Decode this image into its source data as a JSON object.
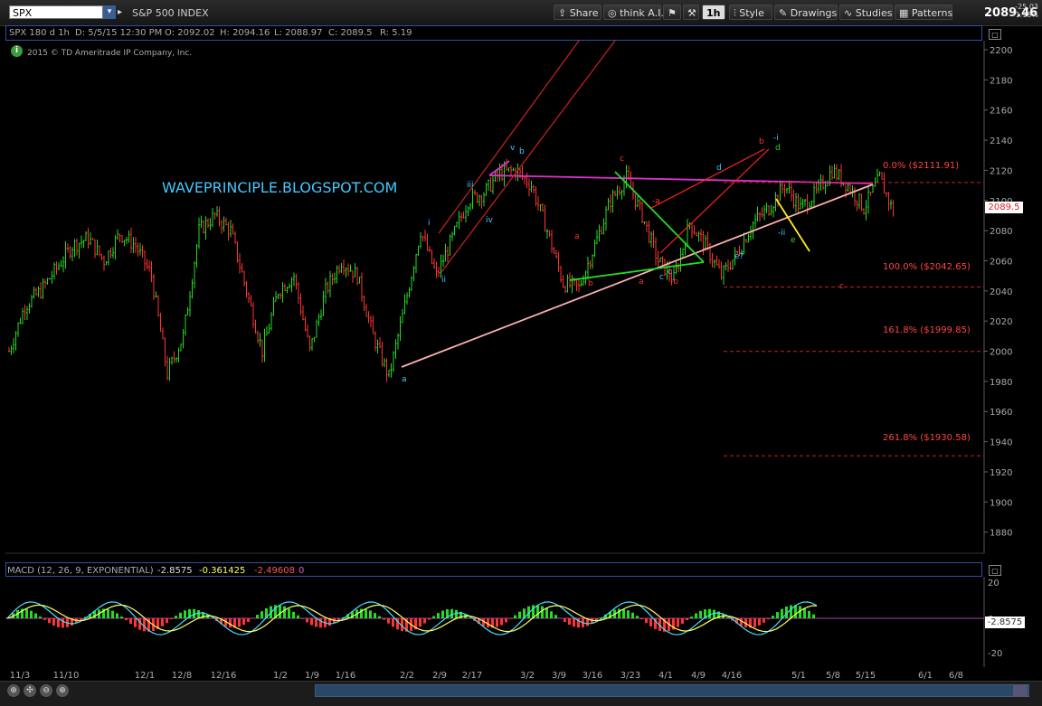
{
  "toolbar": {
    "symbol": "SPX",
    "description": "S&P 500 INDEX",
    "buttons": [
      {
        "name": "share-button",
        "label": "Share"
      },
      {
        "name": "think-ai-button",
        "label": "think A.I."
      },
      {
        "name": "timeframe-button",
        "label": "1h"
      },
      {
        "name": "style-button",
        "label": "Style"
      },
      {
        "name": "drawings-button",
        "label": "Drawings"
      },
      {
        "name": "studies-button",
        "label": "Studies"
      },
      {
        "name": "patterns-button",
        "label": "Patterns"
      }
    ],
    "last_price": "2089.46",
    "change": "-25.03",
    "change_pct": "-1.18%"
  },
  "infobar": {
    "chart_id": "SPX 180 d 1h",
    "date": "D: 5/5/15 12:30 PM",
    "open": "O: 2092.02",
    "high": "H: 2094.16",
    "low": "L: 2088.97",
    "close": "C: 2089.5",
    "range": "R: 5.19"
  },
  "copyright": "2015 © TD Ameritrade IP Company, Inc.",
  "watermark": "WAVEPRINCIPLE.BLOGSPOT.COM",
  "price_tag": "2089.5",
  "fib_levels": [
    {
      "label": "0.0%  ($2111.91)",
      "value": 2111.91
    },
    {
      "label": "100.0%  ($2042.65)",
      "value": 2042.65
    },
    {
      "label": "161.8%  ($1999.85)",
      "value": 1999.85
    },
    {
      "label": "261.8%  ($1930.58)",
      "value": 1930.58
    }
  ],
  "wave_labels": [
    {
      "t": "a",
      "color": "#44c8ff"
    },
    {
      "t": "i",
      "color": "#44c8ff"
    },
    {
      "t": "ii",
      "color": "#44c8ff"
    },
    {
      "t": "iii",
      "color": "#44c8ff"
    },
    {
      "t": "iv",
      "color": "#44c8ff"
    },
    {
      "t": "v",
      "color": "#44c8ff"
    },
    {
      "t": "b",
      "color": "#44c8ff"
    },
    {
      "t": "c",
      "color": "#ff3333"
    },
    {
      "t": "a",
      "color": "#ff3333"
    },
    {
      "t": "b",
      "color": "#ff3333"
    },
    {
      "t": "-a",
      "color": "#ff3333"
    },
    {
      "t": "a",
      "color": "#ff3333"
    },
    {
      "t": "c",
      "color": "#44c8ff"
    },
    {
      "t": "c",
      "color": "#44c8ff"
    },
    {
      "t": "-b",
      "color": "#ff3333"
    },
    {
      "t": "d",
      "color": "#44c8ff"
    },
    {
      "t": "e?",
      "color": "#44c8ff"
    },
    {
      "t": "b",
      "color": "#ff3333"
    },
    {
      "t": "-i",
      "color": "#44c8ff"
    },
    {
      "t": "d",
      "color": "#22dd22"
    },
    {
      "t": "-ii",
      "color": "#44c8ff"
    },
    {
      "t": "e",
      "color": "#22dd22"
    },
    {
      "t": "c",
      "color": "#ff3333"
    }
  ],
  "macd": {
    "title": "MACD (12, 26, 9, EXPONENTIAL)",
    "value": "-2.8575",
    "avg": "-0.361425",
    "diff": "-2.49608",
    "zero": "0",
    "tag": "-2.8575",
    "axis": [
      "20",
      "0",
      "-20"
    ]
  },
  "chart_data": {
    "type": "candlestick",
    "title": "SPX 180 d 1h",
    "y_ticks": [
      2200,
      2180,
      2160,
      2140,
      2120,
      2100,
      2080,
      2060,
      2040,
      2020,
      2000,
      1980,
      1960,
      1940,
      1920,
      1900,
      1880
    ],
    "ylim": [
      1866,
      2206
    ],
    "x_ticks": [
      "11/3",
      "11/10",
      "12/1",
      "12/8",
      "12/16",
      "1/2",
      "1/9",
      "1/16",
      "2/2",
      "2/9",
      "2/17",
      "3/2",
      "3/9",
      "3/16",
      "3/23",
      "4/1",
      "4/9",
      "4/16",
      "5/1",
      "5/8",
      "5/15",
      "6/1",
      "6/8"
    ],
    "x_tick_index": [
      0,
      3,
      6,
      9,
      12,
      15,
      18,
      21,
      24,
      27,
      30,
      33,
      36,
      39,
      42,
      45,
      48,
      51,
      54,
      57,
      60,
      63,
      66
    ],
    "close_path": [
      {
        "i": 0,
        "v": 2000
      },
      {
        "i": 1,
        "v": 2030
      },
      {
        "i": 2,
        "v": 2040
      },
      {
        "i": 3,
        "v": 2055
      },
      {
        "i": 4,
        "v": 2070
      },
      {
        "i": 5,
        "v": 2075
      },
      {
        "i": 6,
        "v": 2060
      },
      {
        "i": 7,
        "v": 2078
      },
      {
        "i": 8,
        "v": 2070
      },
      {
        "i": 9,
        "v": 2050
      },
      {
        "i": 10,
        "v": 1985
      },
      {
        "i": 11,
        "v": 2010
      },
      {
        "i": 12,
        "v": 2080
      },
      {
        "i": 13,
        "v": 2090
      },
      {
        "i": 14,
        "v": 2080
      },
      {
        "i": 15,
        "v": 2040
      },
      {
        "i": 16,
        "v": 2000
      },
      {
        "i": 17,
        "v": 2040
      },
      {
        "i": 18,
        "v": 2050
      },
      {
        "i": 19,
        "v": 2000
      },
      {
        "i": 20,
        "v": 2040
      },
      {
        "i": 21,
        "v": 2060
      },
      {
        "i": 22,
        "v": 2050
      },
      {
        "i": 23,
        "v": 2010
      },
      {
        "i": 24,
        "v": 1983
      },
      {
        "i": 25,
        "v": 2030
      },
      {
        "i": 26,
        "v": 2080
      },
      {
        "i": 27,
        "v": 2050
      },
      {
        "i": 28,
        "v": 2075
      },
      {
        "i": 29,
        "v": 2100
      },
      {
        "i": 30,
        "v": 2105
      },
      {
        "i": 31,
        "v": 2118
      },
      {
        "i": 32,
        "v": 2120
      },
      {
        "i": 33,
        "v": 2110
      },
      {
        "i": 34,
        "v": 2080
      },
      {
        "i": 35,
        "v": 2045
      },
      {
        "i": 36,
        "v": 2042
      },
      {
        "i": 37,
        "v": 2070
      },
      {
        "i": 38,
        "v": 2100
      },
      {
        "i": 39,
        "v": 2115
      },
      {
        "i": 40,
        "v": 2090
      },
      {
        "i": 41,
        "v": 2060
      },
      {
        "i": 42,
        "v": 2048
      },
      {
        "i": 43,
        "v": 2085
      },
      {
        "i": 44,
        "v": 2070
      },
      {
        "i": 45,
        "v": 2050
      },
      {
        "i": 46,
        "v": 2065
      },
      {
        "i": 47,
        "v": 2085
      },
      {
        "i": 48,
        "v": 2095
      },
      {
        "i": 49,
        "v": 2110
      },
      {
        "i": 50,
        "v": 2095
      },
      {
        "i": 51,
        "v": 2105
      },
      {
        "i": 52,
        "v": 2120
      },
      {
        "i": 53,
        "v": 2110
      },
      {
        "i": 54,
        "v": 2095
      },
      {
        "i": 55,
        "v": 2115
      },
      {
        "i": 56,
        "v": 2089
      }
    ]
  }
}
